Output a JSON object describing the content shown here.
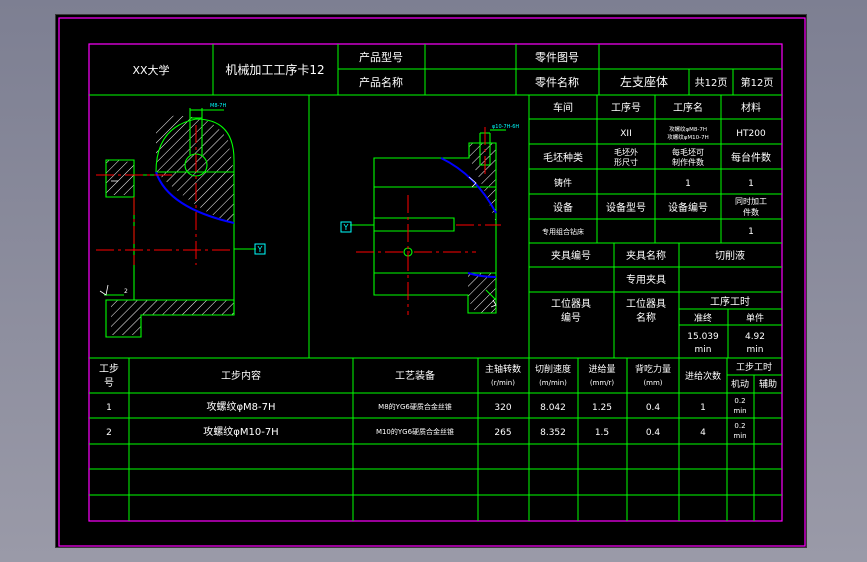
{
  "colors": {
    "frame": "#ff00ff",
    "lines": "#00ff00",
    "text": "#ffffff",
    "red": "#ff0000",
    "cyan": "#00ffff",
    "blue": "#0000ff",
    "yellow": "#ffff00"
  },
  "title_block": {
    "school": "XX大学",
    "card_title": "机械加工工序卡12",
    "product_model_label": "产品型号",
    "product_name_label": "产品名称",
    "part_drawing_label": "零件图号",
    "part_name_label": "零件名称",
    "part_name_value": "左支座体",
    "total_pages": "共12页",
    "page_no": "第12页"
  },
  "info_table": {
    "headers": [
      "车间",
      "工序号",
      "工序名",
      "材料"
    ],
    "process_no": "XII",
    "process_name_lines": [
      "攻螺纹φM8-7H",
      "攻螺纹φM10-7H"
    ],
    "material": "HT200",
    "blank_type_label": "毛坯种类",
    "blank_size_label_lines": [
      "毛坯外",
      "形尺寸"
    ],
    "blank_parts_label_lines": [
      "每毛坯可",
      "制作件数"
    ],
    "units_per_machine_label": "每台件数",
    "blank_type_value": "铸件",
    "blank_parts_value": "1",
    "units_per_machine_value": "1",
    "equipment_label": "设备",
    "equipment_model_label": "设备型号",
    "equipment_no_label": "设备编号",
    "simultaneous_label_lines": [
      "同时加工",
      "件数"
    ],
    "equipment_name": "专用组合钻床",
    "simultaneous_value": "1",
    "fixture_no_label": "夹具编号",
    "fixture_name_label": "夹具名称",
    "coolant_label": "切削液",
    "fixture_name_value": "专用夹具",
    "station_no_label_lines": [
      "工位器具",
      "编号"
    ],
    "station_name_label_lines": [
      "工位器具",
      "名称"
    ],
    "process_time_label": "工序工时",
    "prep_end_label": "准终",
    "unit_label": "单件",
    "prep_end_value_lines": [
      "15.039",
      "min"
    ],
    "unit_value_lines": [
      "4.92",
      "min"
    ]
  },
  "drawing_labels": {
    "datum_right": "Y",
    "datum_left": "Y",
    "top_dim_left": "M8-7H",
    "top_dim_right": "φ10-7H-6H",
    "side_dim": "2"
  },
  "steps_table": {
    "headers": {
      "step_no": [
        "工步",
        "号"
      ],
      "content": "工步内容",
      "equipment": "工艺装备",
      "spindle_speed": [
        "主轴转数",
        "(r/min)"
      ],
      "cutting_speed": [
        "切削速度",
        "(m/min)"
      ],
      "feed": [
        "进给量",
        "(mm/r)"
      ],
      "depth": [
        "背吃力量",
        "(mm)"
      ],
      "passes": "进给次数",
      "step_time": "工步工时",
      "machine": "机动",
      "auxiliary": "辅助"
    },
    "rows": [
      {
        "no": "1",
        "content": "攻螺纹φM8-7H",
        "equipment": "M8的YG6硬质合金丝锥",
        "spindle": "320",
        "cutting": "8.042",
        "feed": "1.25",
        "depth": "0.4",
        "passes": "1",
        "machine": [
          "0.2",
          "min"
        ]
      },
      {
        "no": "2",
        "content": "攻螺纹φM10-7H",
        "equipment": "M10的YG6硬质合金丝锥",
        "spindle": "265",
        "cutting": "8.352",
        "feed": "1.5",
        "depth": "0.4",
        "passes": "4",
        "machine": [
          "0.2",
          "min"
        ]
      }
    ]
  }
}
